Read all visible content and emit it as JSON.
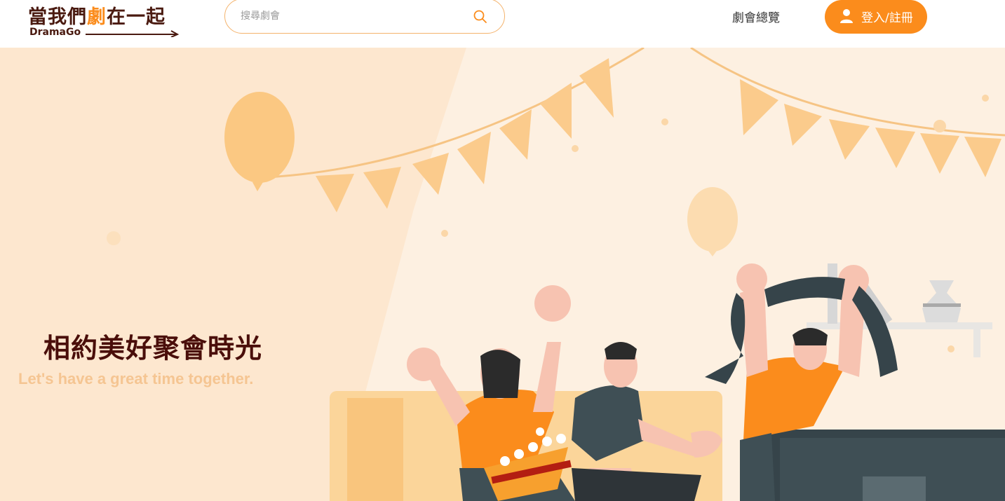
{
  "brand": {
    "title_pre": "當我們",
    "title_accent": "劇",
    "title_post": "在一起",
    "subtitle": "DramaGo"
  },
  "search": {
    "placeholder": "搜尋劇會",
    "icon": "search-icon"
  },
  "nav": {
    "browse_label": "劇會總覽"
  },
  "auth": {
    "login_label": "登入/註冊",
    "icon": "user-icon"
  },
  "hero": {
    "title": "相約美好聚會時光",
    "subtitle": "Let's have a great time together."
  },
  "colors": {
    "accent": "#fb8c1c",
    "brand_dark": "#4a1a10",
    "hero_bg": "#fdf0e1",
    "hero_sub": "#f5c592"
  }
}
